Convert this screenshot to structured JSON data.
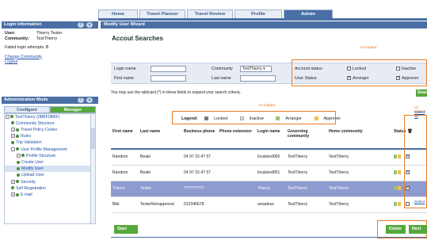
{
  "tabs": [
    "Home",
    "Travel Planner",
    "Travel Review",
    "Profile",
    "Admin"
  ],
  "active_tab": "Admin",
  "login_panel": {
    "title": "Login information",
    "user_label": "User:",
    "user_value": "Thierry Tester",
    "community_label": "Community:",
    "community_value": "TestThierry",
    "failed_label": "Failed login attempts:",
    "failed_value": "0",
    "change_community": "Change Community",
    "logout": "Logout"
  },
  "admin_panel": {
    "title": "Administration Mode",
    "configure_tab": "Configure",
    "manager_tab": "Manager",
    "tree": [
      {
        "label": "TestThierry (0BBF0BBF)",
        "level": 0,
        "toggle": "-"
      },
      {
        "label": "Community Structure",
        "level": 1,
        "toggle": ""
      },
      {
        "label": "Travel Policy Codes",
        "level": 1,
        "toggle": "+"
      },
      {
        "label": "Rules",
        "level": 1,
        "toggle": "+"
      },
      {
        "label": "Trip Validation",
        "level": 1,
        "toggle": ""
      },
      {
        "label": "User Profile Management",
        "level": 1,
        "toggle": "-"
      },
      {
        "label": "Profile Structure",
        "level": 2,
        "toggle": "+"
      },
      {
        "label": "Create User",
        "level": 2,
        "toggle": ""
      },
      {
        "label": "Modify User",
        "level": 2,
        "toggle": "",
        "selected": true
      },
      {
        "label": "Upload User",
        "level": 2,
        "toggle": ""
      },
      {
        "label": "Security",
        "level": 1,
        "toggle": "+"
      },
      {
        "label": "Self Registration",
        "level": 1,
        "toggle": ""
      },
      {
        "label": "E-mail",
        "level": 1,
        "toggle": "+"
      }
    ]
  },
  "wizard": {
    "title": "Modify User Wizard",
    "heading": "Accout Searches",
    "ui_impact": "UI impact",
    "login_name_label": "Login name",
    "first_name_label": "First name",
    "community_label": "Community",
    "community_value": "TestThierry",
    "last_name_label": "Last name",
    "account_status_label": "Account status",
    "user_status_label": "User Status",
    "locked": "Locked",
    "inactive": "Inactive",
    "arranger": "Arranger",
    "approver": "Approver",
    "wildcard_hint": "You may use the wildcard (*) in these fields to expand your search criteria.",
    "search_button": "Search",
    "ui_impact_right": "UI impact",
    "select_all": "Select all",
    "select_link": "Select"
  },
  "legend": {
    "title": "Legend:",
    "items": [
      "Locked",
      "Inactive",
      "Arranger",
      "Approver"
    ]
  },
  "table": {
    "headers": [
      "First name",
      "Last name",
      "Business phone",
      "Phone extension",
      "Login name",
      "Governing community",
      "Home community",
      "Status"
    ],
    "rows": [
      {
        "first": "Random",
        "last": "Beale",
        "phone": "04 97 15 47 57",
        "ext": "",
        "login": "localized050",
        "gov": "TestThierry",
        "home": "TestThierry",
        "highlight": false,
        "checked": true
      },
      {
        "first": "Random",
        "last": "Beale",
        "phone": "04 97 15 47 57",
        "ext": "",
        "login": "localized051",
        "gov": "TestThierry",
        "home": "TestThierry",
        "highlight": false,
        "checked": true
      },
      {
        "first": "Thierry",
        "last": "Tester",
        "phone": "?????????",
        "ext": "",
        "login": "Thierry",
        "gov": "TestThierry",
        "home": "TestThierry",
        "highlight": true,
        "checked": true
      },
      {
        "first": "Bibi",
        "last": "TesterNonapproval",
        "phone": "012345678",
        "ext": "",
        "login": "amadeus",
        "gov": "TestThierry",
        "home": "TestThierry",
        "highlight": false,
        "checked": false
      }
    ]
  },
  "buttons": {
    "start_over": "Start Over",
    "delete": "Delete",
    "next": "Next"
  },
  "colors": {
    "brand_blue": "#4a6fa5",
    "green": "#55a83a",
    "highlight_row": "#8e9bd0",
    "annotation_orange": "#e87d2a"
  }
}
